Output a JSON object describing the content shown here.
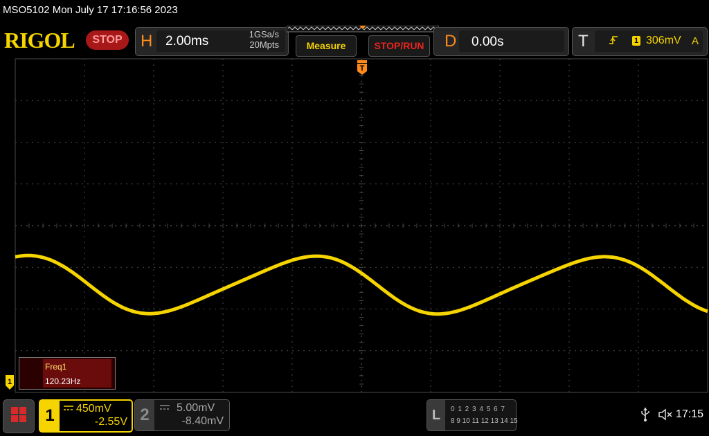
{
  "title_bar": {
    "text": "MSO5102  Mon July 17 17:16:56 2023"
  },
  "brand": {
    "logo_text": "RIGOL",
    "run_state": "STOP"
  },
  "horizontal": {
    "letter": "H",
    "timebase": "2.00ms",
    "sample_rate": "1GSa/s",
    "memory_depth": "20Mpts"
  },
  "buttons": {
    "measure": "Measure",
    "stop_run": "STOP/RUN"
  },
  "delay": {
    "letter": "D",
    "value": "0.00s"
  },
  "trigger": {
    "letter": "T",
    "source": "1",
    "level": "306mV",
    "mode": "A"
  },
  "markers": {
    "trigger_position": "T",
    "ch1_ground": "1"
  },
  "measurement": {
    "label": "Freq1",
    "value": "120.23Hz"
  },
  "channel1": {
    "number": "1",
    "scale": "450mV",
    "offset": "-2.55V"
  },
  "channel2": {
    "number": "2",
    "scale": "5.00mV",
    "offset": "-8.40mV"
  },
  "logic": {
    "letter": "L",
    "row1": "0 1 2 3  4 5 6 7",
    "row2": "8 9 10 11 12 13 14 15"
  },
  "status": {
    "time": "17:15",
    "usb": "usb-icon",
    "sound": "speaker-muted-icon"
  },
  "colors": {
    "ch1": "#f5d400",
    "accent_orange": "#ff8a1a",
    "stop_red": "#e8251f",
    "grid": "#4a4a4a"
  },
  "waveform": {
    "channel": "1",
    "shape": "sine",
    "frequency_hz": 120.23,
    "timebase_per_div": "2.00ms",
    "grid_divisions": {
      "horizontal": 10,
      "vertical": 8
    }
  }
}
